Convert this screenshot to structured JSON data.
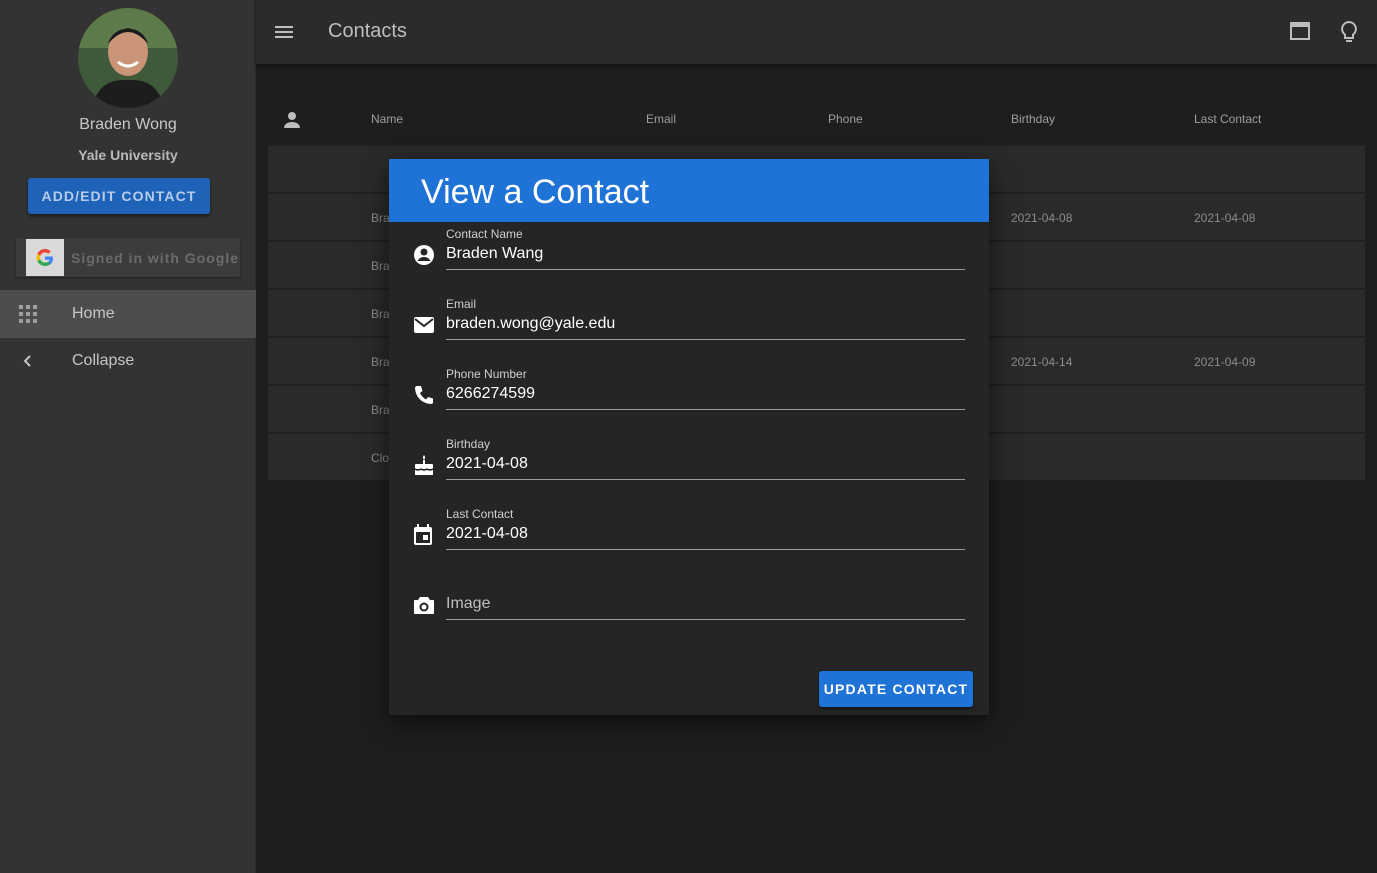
{
  "sidebar": {
    "user_name": "Braden Wong",
    "user_org": "Yale University",
    "add_button_label": "ADD/EDIT CONTACT",
    "google_label": "Signed in with Google",
    "nav": [
      {
        "label": "Home",
        "icon": "apps-grid-icon",
        "active": true
      },
      {
        "label": "Collapse",
        "icon": "chevron-left-icon",
        "active": false
      }
    ]
  },
  "topbar": {
    "title": "Contacts",
    "icons": [
      "menu-icon",
      "window-icon",
      "lightbulb-icon"
    ]
  },
  "table": {
    "headers": [
      "Name",
      "Email",
      "Phone",
      "Birthday",
      "Last Contact"
    ],
    "rows": [
      {
        "name": "",
        "birthday": "",
        "last_contact": ""
      },
      {
        "name": "Bra",
        "birthday": "2021-04-08",
        "last_contact": "2021-04-08"
      },
      {
        "name": "Bra",
        "birthday": "",
        "last_contact": ""
      },
      {
        "name": "Bra",
        "birthday": "",
        "last_contact": ""
      },
      {
        "name": "Bra",
        "birthday": "2021-04-14",
        "last_contact": "2021-04-09"
      },
      {
        "name": "Bra",
        "birthday": "",
        "last_contact": ""
      },
      {
        "name": "Clo",
        "birthday": "",
        "last_contact": ""
      }
    ]
  },
  "dialog": {
    "title": "View a Contact",
    "fields": {
      "name": {
        "label": "Contact Name",
        "value": "Braden Wang"
      },
      "email": {
        "label": "Email",
        "value": "braden.wong@yale.edu"
      },
      "phone": {
        "label": "Phone Number",
        "value": "6266274599"
      },
      "birthday": {
        "label": "Birthday",
        "value": "2021-04-08"
      },
      "last_contact": {
        "label": "Last Contact",
        "value": "2021-04-08"
      },
      "image": {
        "placeholder": "Image"
      }
    },
    "update_button_label": "UPDATE CONTACT"
  },
  "colors": {
    "accent": "#1f72d6",
    "sidebar_button": "#1e63b8",
    "background": "#1e1e1e"
  }
}
